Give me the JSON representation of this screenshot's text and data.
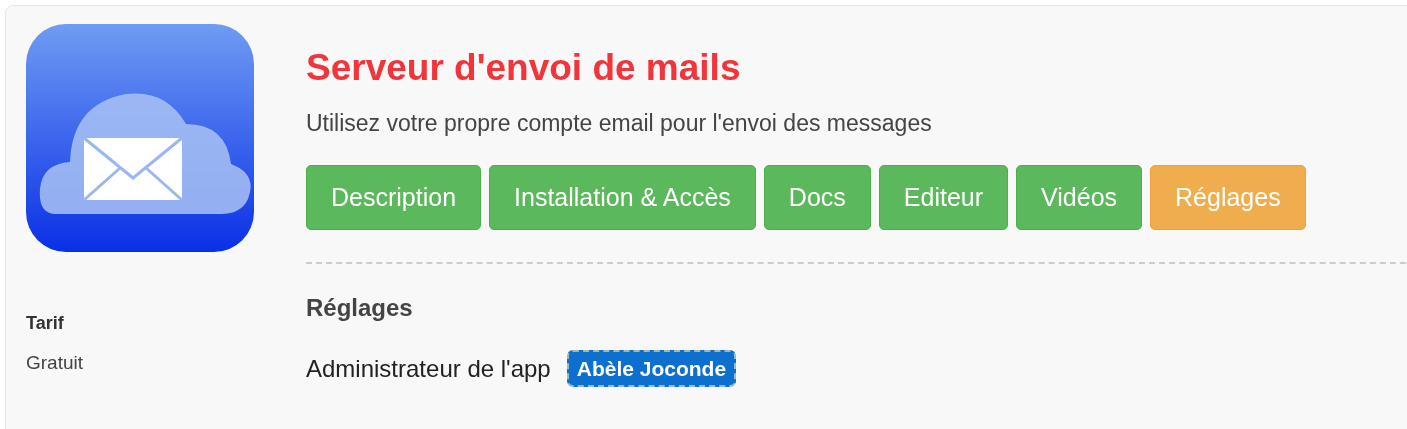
{
  "app": {
    "title": "Serveur d'envoi de mails",
    "subtitle": "Utilisez votre propre compte email pour l'envoi des messages"
  },
  "tabs": [
    {
      "label": "Description",
      "selected": false
    },
    {
      "label": "Installation & Accès",
      "selected": false
    },
    {
      "label": "Docs",
      "selected": false
    },
    {
      "label": "Editeur",
      "selected": false
    },
    {
      "label": "Vidéos",
      "selected": false
    },
    {
      "label": "Réglages",
      "selected": true
    }
  ],
  "sidebar": {
    "label": "Tarif",
    "value": "Gratuit"
  },
  "settings": {
    "heading": "Réglages",
    "admin_label": "Administrateur de l'app",
    "admin_user": "Abèle Joconde"
  }
}
